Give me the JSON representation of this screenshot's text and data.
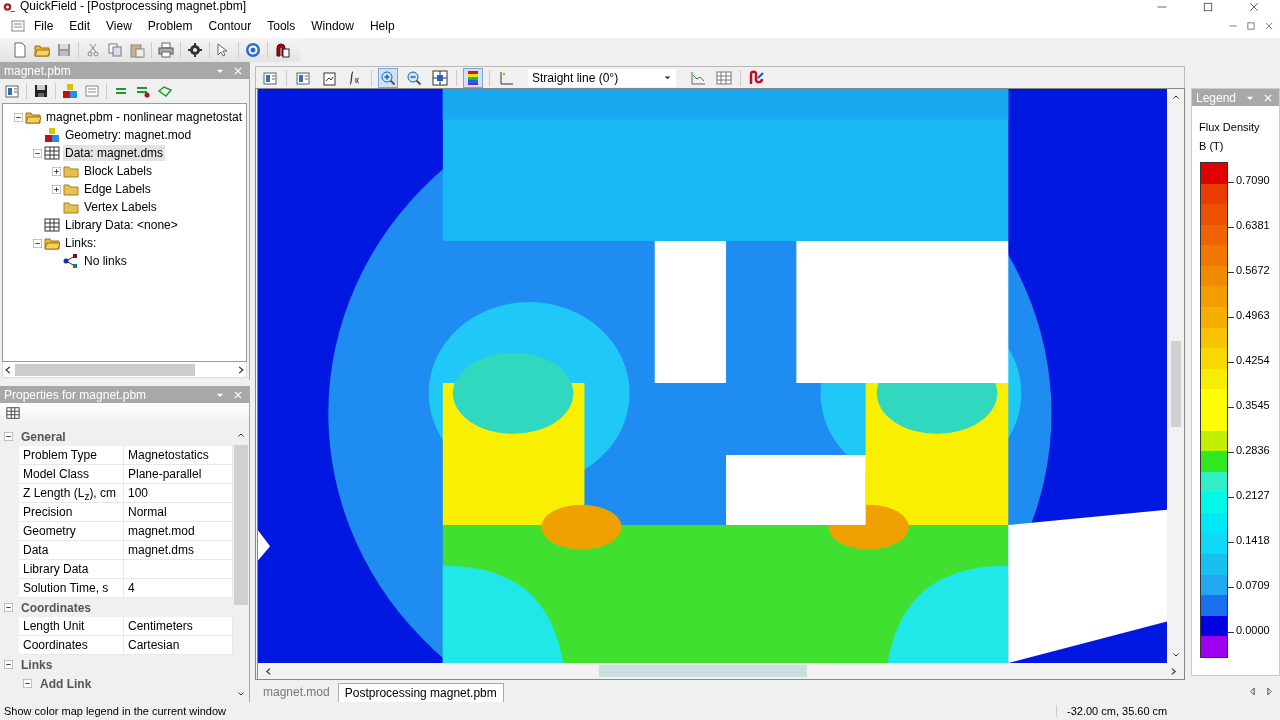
{
  "window": {
    "title": "QuickField - [Postprocessing magnet.pbm]"
  },
  "menu": [
    "File",
    "Edit",
    "View",
    "Problem",
    "Contour",
    "Tools",
    "Window",
    "Help"
  ],
  "explorer": {
    "title": "magnet.pbm",
    "tree": [
      {
        "label": "magnet.pbm - nonlinear magnetostat",
        "kind": "folder-open",
        "expanded": true,
        "selected": false,
        "children": [
          {
            "label": "Geometry: magnet.mod",
            "kind": "blocks",
            "selected": false
          },
          {
            "label": "Data: magnet.dms",
            "kind": "table",
            "expanded": true,
            "selected": true,
            "children": [
              {
                "label": "Block Labels",
                "kind": "folder",
                "expanded": false,
                "selected": false
              },
              {
                "label": "Edge Labels",
                "kind": "folder",
                "expanded": false,
                "selected": false
              },
              {
                "label": "Vertex Labels",
                "kind": "folder",
                "selected": false
              }
            ]
          },
          {
            "label": "Library Data: <none>",
            "kind": "table",
            "selected": false
          },
          {
            "label": "Links:",
            "kind": "folder-open",
            "expanded": true,
            "selected": false,
            "children": [
              {
                "label": "No links",
                "kind": "links",
                "selected": false
              }
            ]
          }
        ]
      }
    ]
  },
  "properties": {
    "title": "Properties for magnet.pbm",
    "groups": [
      {
        "label": "General",
        "expanded": true,
        "rows": [
          {
            "name": "Problem Type",
            "value": "Magnetostatics"
          },
          {
            "name": "Model Class",
            "value": "Plane-parallel"
          },
          {
            "name": "Z Length (L$_{z}$), cm",
            "value": "100"
          },
          {
            "name": "Precision",
            "value": "Normal"
          },
          {
            "name": "Geometry",
            "value": "magnet.mod"
          },
          {
            "name": "Data",
            "value": "magnet.dms"
          },
          {
            "name": "Library Data",
            "value": ""
          },
          {
            "name": "Solution Time, s",
            "value": "4"
          }
        ]
      },
      {
        "label": "Coordinates",
        "expanded": true,
        "rows": [
          {
            "name": "Length Unit",
            "value": "Centimeters"
          },
          {
            "name": "Coordinates",
            "value": "Cartesian"
          }
        ]
      },
      {
        "label": "Links",
        "expanded": true,
        "groups": [
          {
            "label": "Add Link",
            "expanded": true
          }
        ]
      }
    ]
  },
  "view_toolbar": {
    "zoom_in_pressed": true,
    "legend_pressed": true,
    "line_type": "Straight line (0°)"
  },
  "legend": {
    "title": "Legend",
    "quantity": "Flux Density",
    "unit": "B (T)",
    "bands": [
      {
        "color": "#e00000"
      },
      {
        "color": "#e83c00"
      },
      {
        "color": "#ec5000"
      },
      {
        "color": "#f06400"
      },
      {
        "color": "#f07800"
      },
      {
        "color": "#f08a00"
      },
      {
        "color": "#f49c00"
      },
      {
        "color": "#f6ae00"
      },
      {
        "color": "#f8c400"
      },
      {
        "color": "#f8d800"
      },
      {
        "color": "#f8ec00"
      },
      {
        "color": "#ffff00"
      },
      {
        "color": "#ffff00"
      },
      {
        "color": "#c0f000"
      },
      {
        "color": "#30e820"
      },
      {
        "color": "#30f0c8"
      },
      {
        "color": "#00f8e8"
      },
      {
        "color": "#00e8f8"
      },
      {
        "color": "#10d8f8"
      },
      {
        "color": "#18c0f0"
      },
      {
        "color": "#20a8f0"
      },
      {
        "color": "#1870f0"
      },
      {
        "color": "#0000e0"
      },
      {
        "color": "#a000f0"
      }
    ],
    "ticks": [
      "0.7090",
      "0.6381",
      "0.5672",
      "0.4963",
      "0.4254",
      "0.3545",
      "0.2836",
      "0.2127",
      "0.1418",
      "0.0709",
      "0.0000"
    ]
  },
  "doc_tabs": [
    {
      "label": "magnet.mod",
      "selected": false
    },
    {
      "label": "Postprocessing magnet.pbm",
      "selected": true
    }
  ],
  "status_bar": {
    "message": "Show color map legend in the current window",
    "coordinates": "-32.00 cm, 35.60 cm"
  }
}
